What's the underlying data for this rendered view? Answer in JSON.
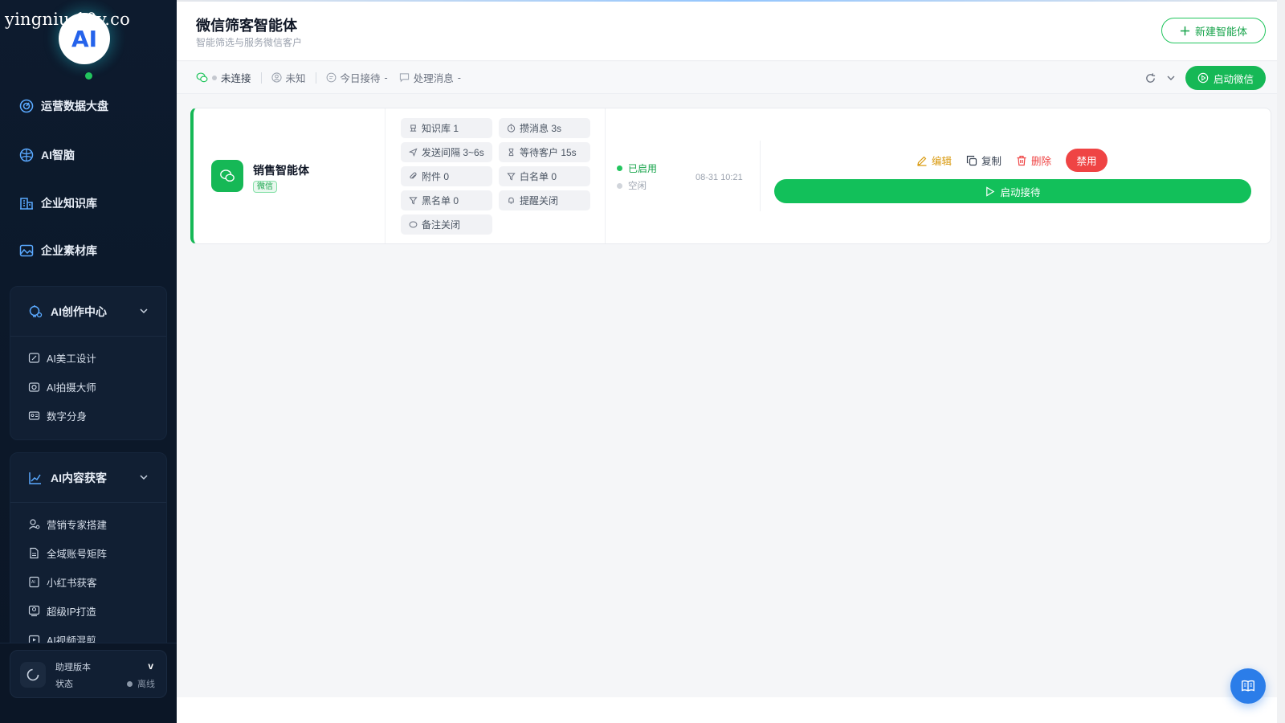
{
  "watermark": "yingniu.10v.co",
  "logo": {
    "text": "AI"
  },
  "sidebar": {
    "items": [
      {
        "label": "运营数据大盘",
        "icon": "dashboard-icon"
      },
      {
        "label": "AI智脑",
        "icon": "brain-icon"
      },
      {
        "label": "企业知识库",
        "icon": "building-icon"
      },
      {
        "label": "企业素材库",
        "icon": "image-icon"
      }
    ],
    "groups": [
      {
        "label": "AI创作中心",
        "icon": "creative-icon",
        "items": [
          {
            "label": "AI美工设计",
            "icon": "design-icon"
          },
          {
            "label": "AI拍摄大师",
            "icon": "camera-icon"
          },
          {
            "label": "数字分身",
            "icon": "avatar-card-icon"
          }
        ]
      },
      {
        "label": "AI内容获客",
        "icon": "chart-line-icon",
        "items": [
          {
            "label": "营销专家搭建",
            "icon": "user-gear-icon"
          },
          {
            "label": "全域账号矩阵",
            "icon": "document-icon"
          },
          {
            "label": "小红书获客",
            "icon": "ai-doc-icon"
          },
          {
            "label": "超级IP打造",
            "icon": "ip-icon"
          },
          {
            "label": "AI视频混剪",
            "icon": "video-icon"
          }
        ]
      }
    ],
    "version": {
      "title": "助理版本",
      "value": "v",
      "status_label": "状态",
      "status_value": "离线"
    }
  },
  "header": {
    "title": "微信筛客智能体",
    "subtitle": "智能筛选与服务微信客户",
    "new_button": "新建智能体"
  },
  "statusbar": {
    "connection": "未连接",
    "user": "未知",
    "today_reception_label": "今日接待",
    "today_reception_value": "-",
    "process_msg_label": "处理消息",
    "process_msg_value": "-",
    "start_button": "启动微信"
  },
  "agent": {
    "name": "销售智能体",
    "tag": "微信",
    "chips": [
      {
        "label": "知识库 1",
        "icon": "knowledge-icon"
      },
      {
        "label": "攒消息 3s",
        "icon": "timer-icon"
      },
      {
        "label": "发送间隔 3~6s",
        "icon": "send-icon"
      },
      {
        "label": "等待客户 15s",
        "icon": "hourglass-icon"
      },
      {
        "label": "附件 0",
        "icon": "paperclip-icon"
      },
      {
        "label": "白名单 0",
        "icon": "filter-icon"
      },
      {
        "label": "黑名单 0",
        "icon": "filter-icon"
      },
      {
        "label": "提醒关闭",
        "icon": "bell-icon"
      },
      {
        "label": "备注关闭",
        "icon": "comment-icon"
      }
    ],
    "status_enabled": "已启用",
    "status_idle": "空闲",
    "time": "08-31 10:21",
    "actions": {
      "edit": "编辑",
      "copy": "复制",
      "delete": "删除",
      "disable": "禁用"
    },
    "start_reception": "启动接待"
  },
  "colors": {
    "brand_green": "#16b856",
    "danger": "#ef4444",
    "warning": "#d99a0f",
    "sidebar_bg": "#0d1b2e",
    "float_blue": "#2b7de9"
  }
}
